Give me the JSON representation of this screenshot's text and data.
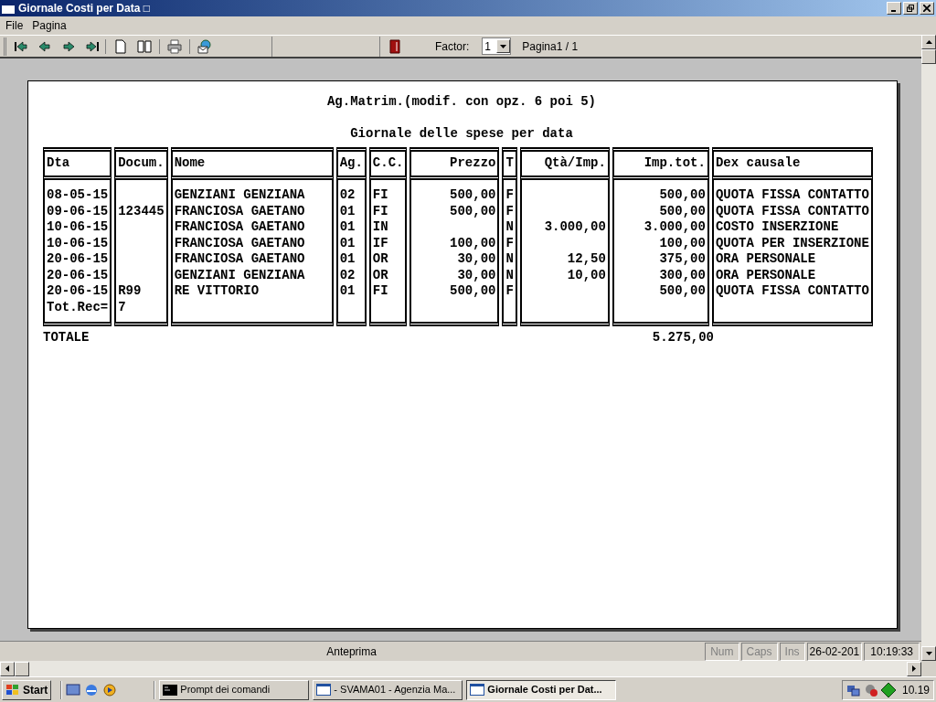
{
  "window": {
    "title": "Giornale Costi per Data □"
  },
  "menu": [
    "File",
    "Pagina"
  ],
  "toolbar": {
    "factor_label": "Factor:",
    "factor_value": "1",
    "page_label": "Pagina1 / 1"
  },
  "report": {
    "title": "Ag.Matrim.(modif. con opz. 6 poi 5)",
    "subtitle": "Giornale delle spese per data",
    "columns": [
      "Dta",
      "Docum.",
      "Nome",
      "Ag.",
      "C.C.",
      "Prezzo",
      "T",
      "Qtà/Imp.",
      "Imp.tot.",
      "Dex causale"
    ],
    "rows": [
      {
        "dta": "08-05-15",
        "nome": "GENZIANI GENZIANA",
        "ag": "02",
        "cc": "FI",
        "prezzo": "500,00",
        "t": "F",
        "imp": "500,00",
        "causale": "QUOTA FISSA CONTATTO"
      },
      {
        "dta": "09-06-15",
        "docum": "123445",
        "nome": "FRANCIOSA GAETANO",
        "ag": "01",
        "cc": "FI",
        "prezzo": "500,00",
        "t": "F",
        "imp": "500,00",
        "causale": "QUOTA FISSA CONTATTO"
      },
      {
        "dta": "10-06-15",
        "nome": "FRANCIOSA GAETANO",
        "ag": "01",
        "cc": "IN",
        "t": "N",
        "qta": "3.000,00",
        "imp": "3.000,00",
        "causale": "COSTO INSERZIONE"
      },
      {
        "dta": "10-06-15",
        "nome": "FRANCIOSA GAETANO",
        "ag": "01",
        "cc": "IF",
        "prezzo": "100,00",
        "t": "F",
        "imp": "100,00",
        "causale": "QUOTA PER INSERZIONE"
      },
      {
        "dta": "20-06-15",
        "nome": "FRANCIOSA GAETANO",
        "ag": "01",
        "cc": "OR",
        "prezzo": "30,00",
        "t": "N",
        "qta": "12,50",
        "imp": "375,00",
        "causale": "ORA PERSONALE"
      },
      {
        "dta": "20-06-15",
        "nome": "GENZIANI GENZIANA",
        "ag": "02",
        "cc": "OR",
        "prezzo": "30,00",
        "t": "N",
        "qta": "10,00",
        "imp": "300,00",
        "causale": "ORA PERSONALE"
      },
      {
        "dta": "20-06-15",
        "docum": "R99",
        "nome": "RE VITTORIO",
        "ag": "01",
        "cc": "FI",
        "prezzo": "500,00",
        "t": "F",
        "imp": "500,00",
        "causale": "QUOTA FISSA CONTATTO"
      },
      {
        "dta": "Tot.Rec=",
        "docum": "7"
      }
    ],
    "total_label": "TOTALE",
    "total_value": "5.275,00"
  },
  "status_bar": {
    "message": "Anteprima",
    "indicators": [
      {
        "label": "Num",
        "on": false
      },
      {
        "label": "Caps",
        "on": false
      },
      {
        "label": "Ins",
        "on": false
      }
    ],
    "date": "26-02-201",
    "time": "10:19:33"
  },
  "taskbar": {
    "start": "Start",
    "tasks": [
      {
        "label": "Prompt dei comandi",
        "kind": "console",
        "selected": false
      },
      {
        "label": "- SVAMA01 - Agenzia Ma...",
        "kind": "window",
        "selected": false
      },
      {
        "label": "Giornale Costi per Dat...",
        "kind": "window",
        "selected": true
      }
    ],
    "clock": "10.19"
  }
}
